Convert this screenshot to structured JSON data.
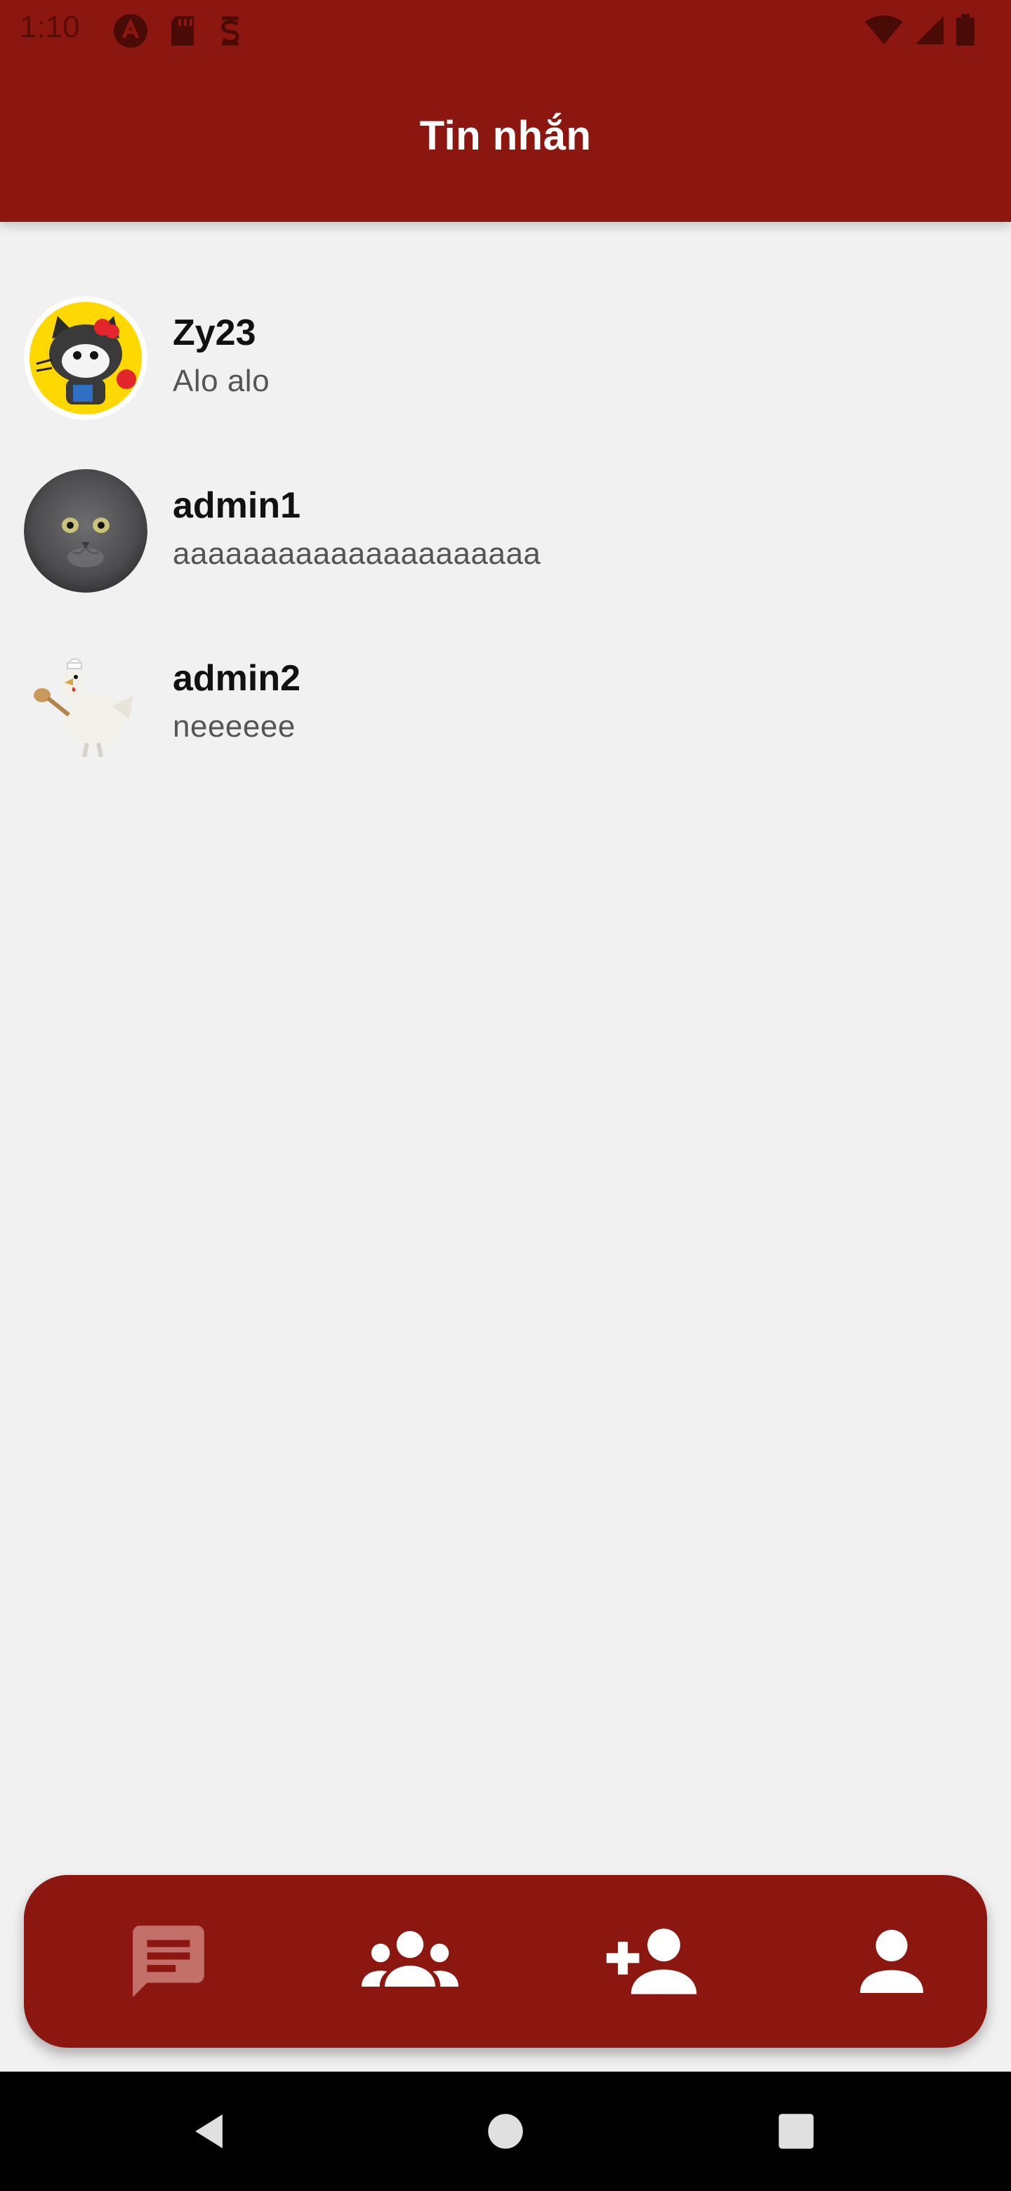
{
  "status_bar": {
    "time": "1:10"
  },
  "header": {
    "title": "Tin nhắn"
  },
  "conversations": [
    {
      "name": "Zy23",
      "preview": "Alo alo",
      "avatar_icon": "hello-kitty-cat-avatar"
    },
    {
      "name": "admin1",
      "preview": "aaaaaaaaaaaaaaaaaaaaa",
      "avatar_icon": "gray-cat-avatar"
    },
    {
      "name": "admin2",
      "preview": "neeeeee",
      "avatar_icon": "chef-chicken-avatar"
    }
  ],
  "bottom_nav": {
    "items": [
      {
        "icon": "chat-icon",
        "active": true
      },
      {
        "icon": "group-icon",
        "active": false
      },
      {
        "icon": "add-friend-icon",
        "active": false
      },
      {
        "icon": "profile-icon",
        "active": false
      }
    ]
  },
  "colors": {
    "primary": "#8b1710",
    "background": "#f1f1f1",
    "active_icon": "#c4706a"
  }
}
